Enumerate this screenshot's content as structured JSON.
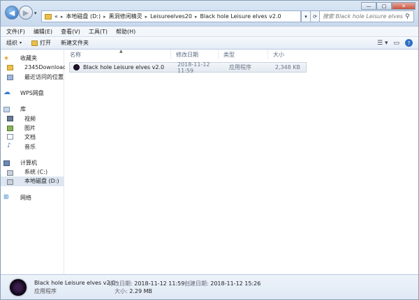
{
  "address": {
    "prefix": "«",
    "crumbs": [
      "本地磁盘 (D:)",
      "黑洞修闲精灵",
      "Leisureelves20",
      "Black hole Leisure elves v2.0"
    ]
  },
  "search": {
    "placeholder": "搜索 Black hole Leisure elves v2.0"
  },
  "window": {
    "minimize": "—",
    "maximize": "□",
    "close": "✕"
  },
  "menu": [
    "文件(F)",
    "编辑(E)",
    "查看(V)",
    "工具(T)",
    "帮助(H)"
  ],
  "toolbar": {
    "organize": "组织",
    "open": "打开",
    "new_folder": "新建文件夹"
  },
  "nav": {
    "favorites": "收藏夹",
    "fav_items": [
      "2345Downloads",
      "最近访问的位置"
    ],
    "wps": "WPS网盘",
    "libraries": "库",
    "lib_items": [
      "视频",
      "图片",
      "文档",
      "音乐"
    ],
    "computer": "计算机",
    "drives": [
      "系统 (C:)",
      "本地磁盘 (D:)"
    ],
    "network": "网络"
  },
  "columns": {
    "name": "名称",
    "date": "修改日期",
    "type": "类型",
    "size": "大小"
  },
  "files": [
    {
      "name": "Black hole Leisure elves v2.0",
      "date": "2018-11-12 11:59",
      "type": "应用程序",
      "size": "2,348 KB"
    }
  ],
  "details": {
    "name": "Black hole Leisure elves v2.0",
    "type": "应用程序",
    "modified_label": "修改日期:",
    "modified_value": "2018-11-12 11:59",
    "size_label": "大小:",
    "size_value": "2.29 MB",
    "created_label": "创建日期:",
    "created_value": "2018-11-12 15:26"
  }
}
